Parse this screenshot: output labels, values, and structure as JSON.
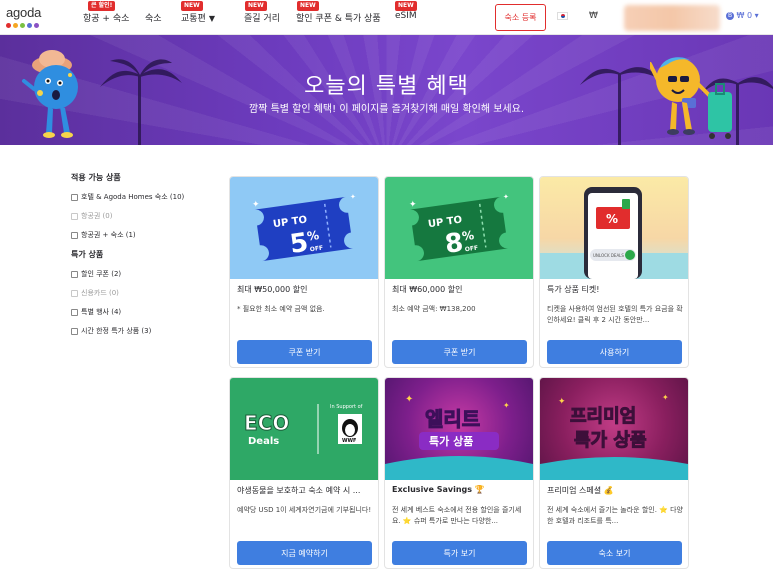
{
  "logo": {
    "text": "agoda"
  },
  "nav": {
    "items": [
      {
        "label": "항공 + 숙소",
        "badge": "큰 할인!"
      },
      {
        "label": "숙소",
        "badge": ""
      },
      {
        "label": "교통편",
        "badge": "NEW"
      },
      {
        "label": "즐길 거리",
        "badge": "NEW"
      },
      {
        "label": "할인 쿠폰 & 특가 상품",
        "badge": "NEW"
      },
      {
        "label": "eSIM",
        "badge": "NEW"
      }
    ],
    "list_property": "숙소 등록",
    "currency": "₩",
    "wallet": "₩ 0",
    "wallet_icon": "coin-icon"
  },
  "hero": {
    "title": "오늘의 특별 혜택",
    "subtitle": "깜짝 특별 할인 혜택! 이 페이지를 즐겨찾기해 매일 확인해 보세요."
  },
  "sidebar": {
    "group1_title": "적용 가능 상품",
    "group1": [
      {
        "label": "호텔 & Agoda Homes 숙소 (10)",
        "disabled": false
      },
      {
        "label": "항공권 (0)",
        "disabled": true
      },
      {
        "label": "항공권 + 숙소 (1)",
        "disabled": false
      }
    ],
    "group2_title": "특가 상품",
    "group2": [
      {
        "label": "할인 쿠폰 (2)",
        "disabled": false
      },
      {
        "label": "신용카드 (0)",
        "disabled": true
      },
      {
        "label": "특별 행사 (4)",
        "disabled": false
      },
      {
        "label": "시간 한정 특가 상품 (3)",
        "disabled": false
      }
    ]
  },
  "cards": [
    {
      "ticket_top": "UP TO",
      "ticket_num": "5",
      "ticket_unit": "%",
      "ticket_off": "OFF",
      "title": "최대 ₩50,000 할인",
      "desc": "* 필요한 최소 예약 금액 없음.",
      "button": "쿠폰 받기"
    },
    {
      "ticket_top": "UP TO",
      "ticket_num": "8",
      "ticket_unit": "%",
      "ticket_off": "OFF",
      "title": "최대 ₩60,000 할인",
      "desc": "최소 예약 금액: ₩138,200",
      "button": "쿠폰 받기"
    },
    {
      "phone_label": "UNLOCK DEALS",
      "title": "특가 상품 티켓!",
      "desc": "티켓을 사용하여 엄선된 호텔의 특가 요금을 확인하세요! 클릭 후 2 시간 동안만...",
      "button": "사용하기"
    },
    {
      "eco_big": "ECO",
      "eco_small": "Deals",
      "support_text": "In Support of",
      "wwf": "WWF",
      "title": "야생동물을 보호하고 숙소 예약 시 ...",
      "desc": "예약당 USD 1이 세계자연기금에 기부됩니다!",
      "button": "지금 예약하기"
    },
    {
      "img_line1": "엘리트",
      "img_line2": "특가 상품",
      "title": "Exclusive Savings 🏆",
      "desc": "전 세계 베스트 숙소에서 전용 할인을 즐기세요. ⭐ 슈퍼 특가로 만나는 다양한...",
      "button": "특가 보기"
    },
    {
      "img_line1": "프리미엄",
      "img_line2": "특가 상품",
      "title": "프리미엄 스페셜 💰",
      "desc": "전 세계 숙소에서 즐기는 놀라운 할인. ⭐ 다양한 호텔과 리조트를 특...",
      "button": "숙소 보기"
    }
  ],
  "colors": {
    "brand_purple": "#6c3bbd",
    "button_blue": "#3f7ee0",
    "badge_red": "#e12d2d"
  }
}
